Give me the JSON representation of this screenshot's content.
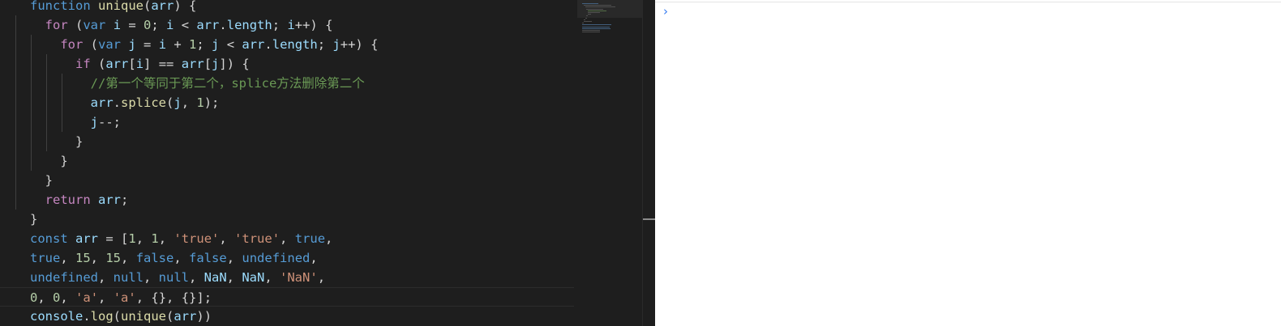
{
  "editor": {
    "lines": [
      [
        {
          "t": "function",
          "c": "kw"
        },
        {
          "t": " "
        },
        {
          "t": "unique",
          "c": "fn"
        },
        {
          "t": "("
        },
        {
          "t": "arr",
          "c": "var"
        },
        {
          "t": ") {"
        }
      ],
      [
        {
          "t": "  "
        },
        {
          "t": "for",
          "c": "ctl"
        },
        {
          "t": " ("
        },
        {
          "t": "var",
          "c": "kw"
        },
        {
          "t": " "
        },
        {
          "t": "i",
          "c": "var"
        },
        {
          "t": " = "
        },
        {
          "t": "0",
          "c": "num"
        },
        {
          "t": "; "
        },
        {
          "t": "i",
          "c": "var"
        },
        {
          "t": " < "
        },
        {
          "t": "arr",
          "c": "var"
        },
        {
          "t": "."
        },
        {
          "t": "length",
          "c": "var"
        },
        {
          "t": "; "
        },
        {
          "t": "i",
          "c": "var"
        },
        {
          "t": "++) {"
        }
      ],
      [
        {
          "t": "    "
        },
        {
          "t": "for",
          "c": "ctl"
        },
        {
          "t": " ("
        },
        {
          "t": "var",
          "c": "kw"
        },
        {
          "t": " "
        },
        {
          "t": "j",
          "c": "var"
        },
        {
          "t": " = "
        },
        {
          "t": "i",
          "c": "var"
        },
        {
          "t": " + "
        },
        {
          "t": "1",
          "c": "num"
        },
        {
          "t": "; "
        },
        {
          "t": "j",
          "c": "var"
        },
        {
          "t": " < "
        },
        {
          "t": "arr",
          "c": "var"
        },
        {
          "t": "."
        },
        {
          "t": "length",
          "c": "var"
        },
        {
          "t": "; "
        },
        {
          "t": "j",
          "c": "var"
        },
        {
          "t": "++) {"
        }
      ],
      [
        {
          "t": "      "
        },
        {
          "t": "if",
          "c": "ctl"
        },
        {
          "t": " ("
        },
        {
          "t": "arr",
          "c": "var"
        },
        {
          "t": "["
        },
        {
          "t": "i",
          "c": "var"
        },
        {
          "t": "] == "
        },
        {
          "t": "arr",
          "c": "var"
        },
        {
          "t": "["
        },
        {
          "t": "j",
          "c": "var"
        },
        {
          "t": "]) {"
        }
      ],
      [
        {
          "t": "        "
        },
        {
          "t": "//第一个等同于第二个，splice方法删除第二个",
          "c": "cmt"
        }
      ],
      [
        {
          "t": "        "
        },
        {
          "t": "arr",
          "c": "var"
        },
        {
          "t": "."
        },
        {
          "t": "splice",
          "c": "fn"
        },
        {
          "t": "("
        },
        {
          "t": "j",
          "c": "var"
        },
        {
          "t": ", "
        },
        {
          "t": "1",
          "c": "num"
        },
        {
          "t": ");"
        }
      ],
      [
        {
          "t": "        "
        },
        {
          "t": "j",
          "c": "var"
        },
        {
          "t": "--;"
        }
      ],
      [
        {
          "t": "      }"
        }
      ],
      [
        {
          "t": "    }"
        }
      ],
      [
        {
          "t": "  }"
        }
      ],
      [
        {
          "t": "  "
        },
        {
          "t": "return",
          "c": "ctl"
        },
        {
          "t": " "
        },
        {
          "t": "arr",
          "c": "var"
        },
        {
          "t": ";"
        }
      ],
      [
        {
          "t": "}"
        }
      ],
      [
        {
          "t": "const",
          "c": "kw"
        },
        {
          "t": " "
        },
        {
          "t": "arr",
          "c": "var"
        },
        {
          "t": " = ["
        },
        {
          "t": "1",
          "c": "num"
        },
        {
          "t": ", "
        },
        {
          "t": "1",
          "c": "num"
        },
        {
          "t": ", "
        },
        {
          "t": "'true'",
          "c": "str"
        },
        {
          "t": ", "
        },
        {
          "t": "'true'",
          "c": "str"
        },
        {
          "t": ", "
        },
        {
          "t": "true",
          "c": "kw"
        },
        {
          "t": ","
        }
      ],
      [
        {
          "t": "true",
          "c": "kw"
        },
        {
          "t": ", "
        },
        {
          "t": "15",
          "c": "num"
        },
        {
          "t": ", "
        },
        {
          "t": "15",
          "c": "num"
        },
        {
          "t": ", "
        },
        {
          "t": "false",
          "c": "kw"
        },
        {
          "t": ", "
        },
        {
          "t": "false",
          "c": "kw"
        },
        {
          "t": ", "
        },
        {
          "t": "undefined",
          "c": "kw"
        },
        {
          "t": ","
        }
      ],
      [
        {
          "t": "undefined",
          "c": "kw"
        },
        {
          "t": ", "
        },
        {
          "t": "null",
          "c": "kw"
        },
        {
          "t": ", "
        },
        {
          "t": "null",
          "c": "kw"
        },
        {
          "t": ", "
        },
        {
          "t": "NaN",
          "c": "var"
        },
        {
          "t": ", "
        },
        {
          "t": "NaN",
          "c": "var"
        },
        {
          "t": ", "
        },
        {
          "t": "'NaN'",
          "c": "str"
        },
        {
          "t": ","
        }
      ],
      [
        {
          "t": "0",
          "c": "num"
        },
        {
          "t": ", "
        },
        {
          "t": "0",
          "c": "num"
        },
        {
          "t": ", "
        },
        {
          "t": "'a'",
          "c": "str"
        },
        {
          "t": ", "
        },
        {
          "t": "'a'",
          "c": "str"
        },
        {
          "t": ", {}, {}];"
        }
      ],
      [
        {
          "t": "console",
          "c": "var"
        },
        {
          "t": "."
        },
        {
          "t": "log",
          "c": "fn"
        },
        {
          "t": "("
        },
        {
          "t": "unique",
          "c": "fn"
        },
        {
          "t": "("
        },
        {
          "t": "arr",
          "c": "var"
        },
        {
          "t": "))"
        }
      ]
    ],
    "indent_levels": [
      0,
      1,
      2,
      3,
      4,
      4,
      4,
      3,
      2,
      1,
      1,
      0,
      0,
      0,
      0,
      0,
      0
    ],
    "current_line": 15
  },
  "console": {
    "prompt_symbol": "›"
  },
  "colors": {
    "editor_bg": "#1e1e1e",
    "keyword": "#569cd6",
    "control": "#c586c0",
    "function": "#dcdcaa",
    "variable": "#9cdcfe",
    "number": "#b5cea8",
    "string": "#ce9178",
    "comment": "#6a9955",
    "console_prompt": "#367cf1"
  }
}
